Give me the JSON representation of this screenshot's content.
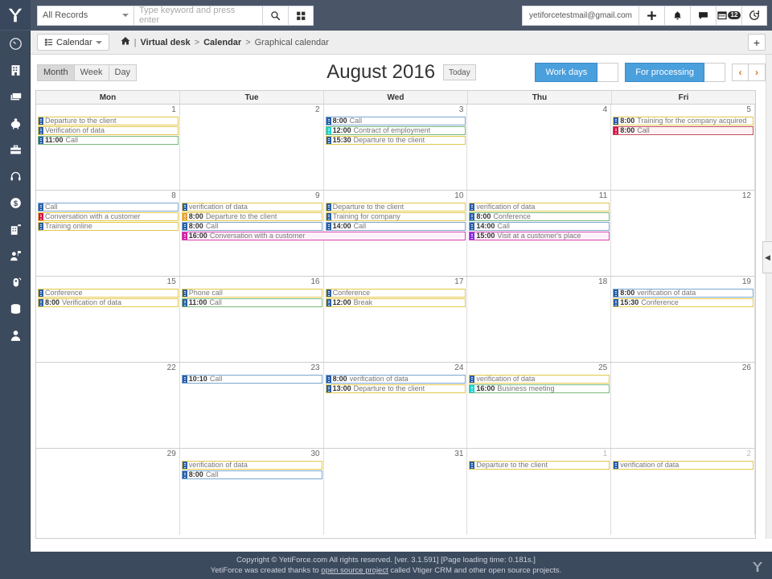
{
  "app": {
    "logo": "yetiforce-logo",
    "footer_line1": "Copyright © YetiForce.com All rights reserved. [ver. 3.1.591] [Page loading time: 0.181s.]",
    "footer_line2_pre": "YetiForce was created thanks to ",
    "footer_link": "open source project",
    "footer_line2_post": " called Vtiger CRM and other open source projects."
  },
  "topbar": {
    "records_filter": "All Records",
    "search_placeholder": "Type keyword and press enter",
    "search_value": "",
    "search_icon": "search-icon",
    "grid_icon": "grid-icon",
    "user_email": "yetiforcetestmail@gmail.com",
    "add_icon": "plus-icon",
    "bell_icon": "bell-icon",
    "chat_icon": "chat-icon",
    "calendar_icon": "calendar-icon",
    "calendar_badge": "12",
    "clock_icon": "clock-icon"
  },
  "breadcrumb": {
    "module_label": "Calendar",
    "module_icon": "list-icon",
    "home_icon": "home-icon",
    "divider": "|",
    "item1": "Virtual desk",
    "sep": ">",
    "item2": "Calendar",
    "item3": "Graphical calendar",
    "add_label": "+"
  },
  "toolbar": {
    "views": [
      {
        "label": "Month",
        "active": true
      },
      {
        "label": "Week",
        "active": false
      },
      {
        "label": "Day",
        "active": false
      }
    ],
    "title": "August 2016",
    "today_label": "Today",
    "workdays_label": "Work days",
    "processing_label": "For processing",
    "prev_label": "‹",
    "next_label": "›",
    "accent_blue": "#4a9fdd",
    "collapse_icon": "chevron-left-icon"
  },
  "sidebar": {
    "items": [
      {
        "name": "dashboard",
        "icon": "gauge-icon"
      },
      {
        "name": "organizations",
        "icon": "building-icon"
      },
      {
        "name": "documents",
        "icon": "stack-icon"
      },
      {
        "name": "finances",
        "icon": "piggy-bank-icon"
      },
      {
        "name": "projects",
        "icon": "briefcase-icon"
      },
      {
        "name": "support",
        "icon": "headset-icon"
      },
      {
        "name": "sales",
        "icon": "dollar-icon"
      },
      {
        "name": "assets",
        "icon": "building-alt-icon"
      },
      {
        "name": "contacts",
        "icon": "user-flag-icon"
      },
      {
        "name": "campaigns",
        "icon": "megaphone-icon"
      },
      {
        "name": "database",
        "icon": "database-icon"
      },
      {
        "name": "account",
        "icon": "person-icon"
      }
    ]
  },
  "calendar": {
    "day_headers": [
      "Mon",
      "Tue",
      "Wed",
      "Thu",
      "Fri"
    ],
    "weeks": [
      {
        "days": [
          {
            "num": "1",
            "other": false
          },
          {
            "num": "2",
            "other": false
          },
          {
            "num": "3",
            "other": false
          },
          {
            "num": "4",
            "other": false
          },
          {
            "num": "5",
            "other": false
          }
        ],
        "events": [
          {
            "col": 0,
            "span": 1,
            "row": 0,
            "time": "",
            "title": "Departure to the client",
            "border": "b-yellow",
            "bar": "c-blue"
          },
          {
            "col": 0,
            "span": 1,
            "row": 1,
            "time": "",
            "title": "Verification of data",
            "border": "b-yellow",
            "bar": "c-blue"
          },
          {
            "col": 0,
            "span": 1,
            "row": 2,
            "time": "11:00",
            "title": "Call",
            "border": "b-green",
            "bar": "c-blue"
          },
          {
            "col": 2,
            "span": 1,
            "row": 0,
            "time": "8:00",
            "title": "Call",
            "border": "b-blue",
            "bar": "c-blue"
          },
          {
            "col": 2,
            "span": 1,
            "row": 1,
            "time": "12:00",
            "title": "Contract of employment",
            "border": "b-green",
            "bar": "c-cyan"
          },
          {
            "col": 2,
            "span": 1,
            "row": 2,
            "time": "15:30",
            "title": "Departure to the client",
            "border": "b-yellow",
            "bar": "c-blue"
          },
          {
            "col": 4,
            "span": 1,
            "row": 0,
            "time": "8:00",
            "title": "Training for the company acquired",
            "border": "b-yellow",
            "bar": "c-blue"
          },
          {
            "col": 4,
            "span": 1,
            "row": 1,
            "time": "8:00",
            "title": "Call",
            "border": "b-red",
            "bar": "c-crimson"
          }
        ]
      },
      {
        "days": [
          {
            "num": "8",
            "other": false
          },
          {
            "num": "9",
            "other": false
          },
          {
            "num": "10",
            "other": false
          },
          {
            "num": "11",
            "other": false
          },
          {
            "num": "12",
            "other": false
          }
        ],
        "events": [
          {
            "col": 0,
            "span": 1,
            "row": 0,
            "time": "",
            "title": "Call",
            "border": "b-blue",
            "bar": "c-blue"
          },
          {
            "col": 0,
            "span": 1,
            "row": 1,
            "time": "",
            "title": "Conversation with a customer",
            "border": "b-yellow",
            "bar": "c-crimson"
          },
          {
            "col": 0,
            "span": 1,
            "row": 2,
            "time": "",
            "title": "Training online",
            "border": "b-yellow",
            "bar": "c-blue"
          },
          {
            "col": 1,
            "span": 1,
            "row": 0,
            "time": "",
            "title": "verification of data",
            "border": "b-yellow",
            "bar": "c-blue"
          },
          {
            "col": 1,
            "span": 1,
            "row": 1,
            "time": "8:00",
            "title": "Departure to the client",
            "border": "b-yellow",
            "bar": "c-orange"
          },
          {
            "col": 1,
            "span": 1,
            "row": 2,
            "time": "8:00",
            "title": "Call",
            "border": "b-blue",
            "bar": "c-blue"
          },
          {
            "col": 1,
            "span": 2,
            "row": 3,
            "time": "16:00",
            "title": "Conversation with a customer",
            "border": "b-pink",
            "bar": "c-magenta"
          },
          {
            "col": 2,
            "span": 1,
            "row": 0,
            "time": "",
            "title": "Departure to the client",
            "border": "b-yellow",
            "bar": "c-blue"
          },
          {
            "col": 2,
            "span": 1,
            "row": 1,
            "time": "",
            "title": "Training for company",
            "border": "b-yellow",
            "bar": "c-blue"
          },
          {
            "col": 2,
            "span": 1,
            "row": 2,
            "time": "14:00",
            "title": "Call",
            "border": "b-blue",
            "bar": "c-blue"
          },
          {
            "col": 3,
            "span": 1,
            "row": 0,
            "time": "",
            "title": "verification of data",
            "border": "b-yellow",
            "bar": "c-blue"
          },
          {
            "col": 3,
            "span": 1,
            "row": 1,
            "time": "8:00",
            "title": "Conference",
            "border": "b-green",
            "bar": "c-blue"
          },
          {
            "col": 3,
            "span": 1,
            "row": 2,
            "time": "14:00",
            "title": "Call",
            "border": "b-blue",
            "bar": "c-blue"
          },
          {
            "col": 3,
            "span": 1,
            "row": 3,
            "time": "15:00",
            "title": "Visit at a customer's place",
            "border": "b-pink",
            "bar": "c-purple"
          }
        ]
      },
      {
        "days": [
          {
            "num": "15",
            "other": false
          },
          {
            "num": "16",
            "other": false
          },
          {
            "num": "17",
            "other": false
          },
          {
            "num": "18",
            "other": false
          },
          {
            "num": "19",
            "other": false
          }
        ],
        "events": [
          {
            "col": 0,
            "span": 1,
            "row": 0,
            "time": "",
            "title": "Conference",
            "border": "b-yellow",
            "bar": "c-blue"
          },
          {
            "col": 0,
            "span": 1,
            "row": 1,
            "time": "8:00",
            "title": "Verification of data",
            "border": "b-yellow",
            "bar": "c-blue"
          },
          {
            "col": 1,
            "span": 1,
            "row": 0,
            "time": "",
            "title": "Phone call",
            "border": "b-yellow",
            "bar": "c-blue"
          },
          {
            "col": 1,
            "span": 1,
            "row": 1,
            "time": "11:00",
            "title": "Call",
            "border": "b-green",
            "bar": "c-blue"
          },
          {
            "col": 2,
            "span": 1,
            "row": 0,
            "time": "",
            "title": "Conference",
            "border": "b-yellow",
            "bar": "c-blue"
          },
          {
            "col": 2,
            "span": 1,
            "row": 1,
            "time": "12:00",
            "title": "Break",
            "border": "b-yellow",
            "bar": "c-blue"
          },
          {
            "col": 4,
            "span": 1,
            "row": 0,
            "time": "8:00",
            "title": "verification of data",
            "border": "b-blue",
            "bar": "c-blue"
          },
          {
            "col": 4,
            "span": 1,
            "row": 1,
            "time": "15:30",
            "title": "Conference",
            "border": "b-yellow",
            "bar": "c-blue"
          }
        ]
      },
      {
        "days": [
          {
            "num": "22",
            "other": false
          },
          {
            "num": "23",
            "other": false
          },
          {
            "num": "24",
            "other": false
          },
          {
            "num": "25",
            "other": false
          },
          {
            "num": "26",
            "other": false
          }
        ],
        "events": [
          {
            "col": 1,
            "span": 1,
            "row": 0,
            "time": "10:10",
            "title": "Call",
            "border": "b-blue",
            "bar": "c-blue"
          },
          {
            "col": 2,
            "span": 1,
            "row": 0,
            "time": "8:00",
            "title": "verification of data",
            "border": "b-blue",
            "bar": "c-blue"
          },
          {
            "col": 2,
            "span": 1,
            "row": 1,
            "time": "13:00",
            "title": "Departure to the client",
            "border": "b-yellow",
            "bar": "c-blue"
          },
          {
            "col": 3,
            "span": 1,
            "row": 0,
            "time": "",
            "title": "verification of data",
            "border": "b-yellow",
            "bar": "c-blue"
          },
          {
            "col": 3,
            "span": 1,
            "row": 1,
            "time": "16:00",
            "title": "Business meeting",
            "border": "b-green",
            "bar": "c-cyan"
          }
        ]
      },
      {
        "days": [
          {
            "num": "29",
            "other": false
          },
          {
            "num": "30",
            "other": false
          },
          {
            "num": "31",
            "other": false
          },
          {
            "num": "1",
            "other": true
          },
          {
            "num": "2",
            "other": true
          }
        ],
        "events": [
          {
            "col": 1,
            "span": 1,
            "row": 0,
            "time": "",
            "title": "verification of data",
            "border": "b-yellow",
            "bar": "c-blue"
          },
          {
            "col": 1,
            "span": 1,
            "row": 1,
            "time": "8:00",
            "title": "Call",
            "border": "b-blue",
            "bar": "c-blue"
          },
          {
            "col": 3,
            "span": 1,
            "row": 0,
            "time": "",
            "title": "Departure to the client",
            "border": "b-yellow",
            "bar": "c-blue"
          },
          {
            "col": 4,
            "span": 1,
            "row": 0,
            "time": "",
            "title": "verification of data",
            "border": "b-yellow",
            "bar": "c-blue"
          }
        ]
      }
    ]
  }
}
